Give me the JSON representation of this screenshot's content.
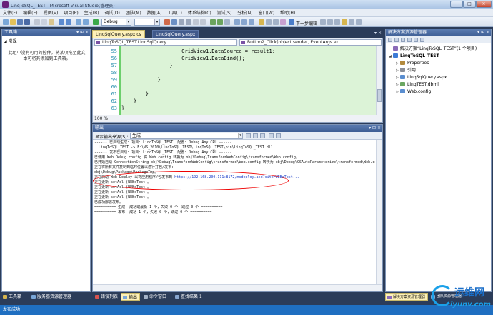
{
  "window": {
    "title": "LinqToSQL_TEST - Microsoft Visual Studio(管理员)",
    "controls": [
      "–",
      "□",
      "×"
    ]
  },
  "menu": [
    "文件(F)",
    "编辑(E)",
    "视图(V)",
    "项目(P)",
    "生成(B)",
    "调试(D)",
    "团队(M)",
    "数据(A)",
    "工具(T)",
    "体系结构(C)",
    "测试(S)",
    "分析(N)",
    "窗口(W)",
    "帮助(H)"
  ],
  "toolbar": {
    "config": "Debug",
    "step_label": "下一步编辑"
  },
  "toolbox": {
    "title": "工具箱",
    "header_buttons": "▾ ⊞ ×",
    "group": "◢ 常规",
    "empty_message": "此组中没有可用的控件。将某项拖至此文本可将其添加到工具箱。"
  },
  "doc_tabs": {
    "active": "LinqSqlQuery.aspx.cs",
    "inactive": "LinqSqlQuery.aspx",
    "buttons": "▾ ×"
  },
  "editor": {
    "nav_left": "LinqToSQL_TEST.LinqSqlQuery",
    "nav_right": "Button2_Click(object sender, EventArgs e)",
    "zoom": "100 %",
    "lines": [
      {
        "num": "55",
        "code": "                    GridView1.DataSource = result1;"
      },
      {
        "num": "56",
        "code": "                    GridView1.DataBind();"
      },
      {
        "num": "57",
        "code": "                }"
      },
      {
        "num": "58",
        "code": ""
      },
      {
        "num": "59",
        "code": "            }"
      },
      {
        "num": "60",
        "code": ""
      },
      {
        "num": "61",
        "code": "        }"
      },
      {
        "num": "62",
        "code": "    }"
      },
      {
        "num": "63",
        "code": "}"
      }
    ]
  },
  "output": {
    "title": "输出",
    "header_buttons": "▾ ⊞ ×",
    "source_label": "显示输出来源(S):",
    "source_value": "生成",
    "lines": [
      "------ 已启动生成: 项目: LinqToSQL_TEST, 配置: Debug Any CPU ------",
      "  LinqToSQL_TEST -> E:\\VS_2010\\LinqToSQL_TEST\\LinqToSQL_TEST\\bin\\LinqToSQL_TEST.dll",
      "------ 发布已启动: 项目: LinqToSQL_TEST, 配置: Debug Any CPU ------",
      "已使用 Web.Debug.config 将 Web.config 转换为 obj\\Debug\\TransformWebConfig\\transformed\\Web.config。",
      "已开始自动 ConnectionString obj\\Debug\\TransformWebConfig\\transformed\\Web.config 转换为 obj\\Debug\\CSAutoParameterize\\transformed\\Web.config",
      "正在将所有文件复制到临时位置以进行打包/发布:",
      "obj\\Debug\\Package\\PackageTmp。",
      "正在启动 Web Deploy 以将应用程序/包发布到 ",
      "正在更新 setAcl (WEBsTest)。",
      "正在更新 setAcl (WEBsTest)。",
      "正在更新 setAcl (WEBsTest)。",
      "正在更新 setAcl (WEBsTest)。",
      "已成功部署发布。",
      "========== 生成: 成功或最新 1 个，失败 0 个，跳过 0 个 ==========",
      "========== 发布: 成功 1 个，失败 0 个，跳过 0 个 =========="
    ],
    "deploy_url": "https://192.168.200.111:8172/msdeploy.axd?site=WEBsTest..."
  },
  "bottom_tabs_left": [
    "工具箱",
    "服务器资源管理器"
  ],
  "bottom_tabs_center": [
    "错误列表",
    "输出",
    "命令窗口",
    "查找结果 1"
  ],
  "bottom_tabs_right": [
    "解决方案资源管理器",
    "团队资源管理器"
  ],
  "solution": {
    "title": "解决方案资源管理器",
    "header_buttons": "▾ ⊞ ×",
    "nodes": [
      {
        "label": "解决方案“LinqToSQL_TEST”(1 个项目)",
        "depth": 0,
        "expander": "",
        "color": "#8a6bb8"
      },
      {
        "label": "LinqToSQL_TEST",
        "depth": 0,
        "expander": "◢",
        "color": "#3c7bd6"
      },
      {
        "label": "Properties",
        "depth": 1,
        "expander": "▷",
        "color": "#b38a3c"
      },
      {
        "label": "引用",
        "depth": 1,
        "expander": "▷",
        "color": "#8a8f98"
      },
      {
        "label": "LinqSqlQuery.aspx",
        "depth": 1,
        "expander": "▷",
        "color": "#5a8ed0"
      },
      {
        "label": "LinqTEST.dbml",
        "depth": 1,
        "expander": "▷",
        "color": "#6aa660"
      },
      {
        "label": "Web.config",
        "depth": 1,
        "expander": "▷",
        "color": "#5a8ed0"
      }
    ]
  },
  "status": "发布成功",
  "watermark": {
    "text": "运维网",
    "url": "iyunv.com"
  }
}
